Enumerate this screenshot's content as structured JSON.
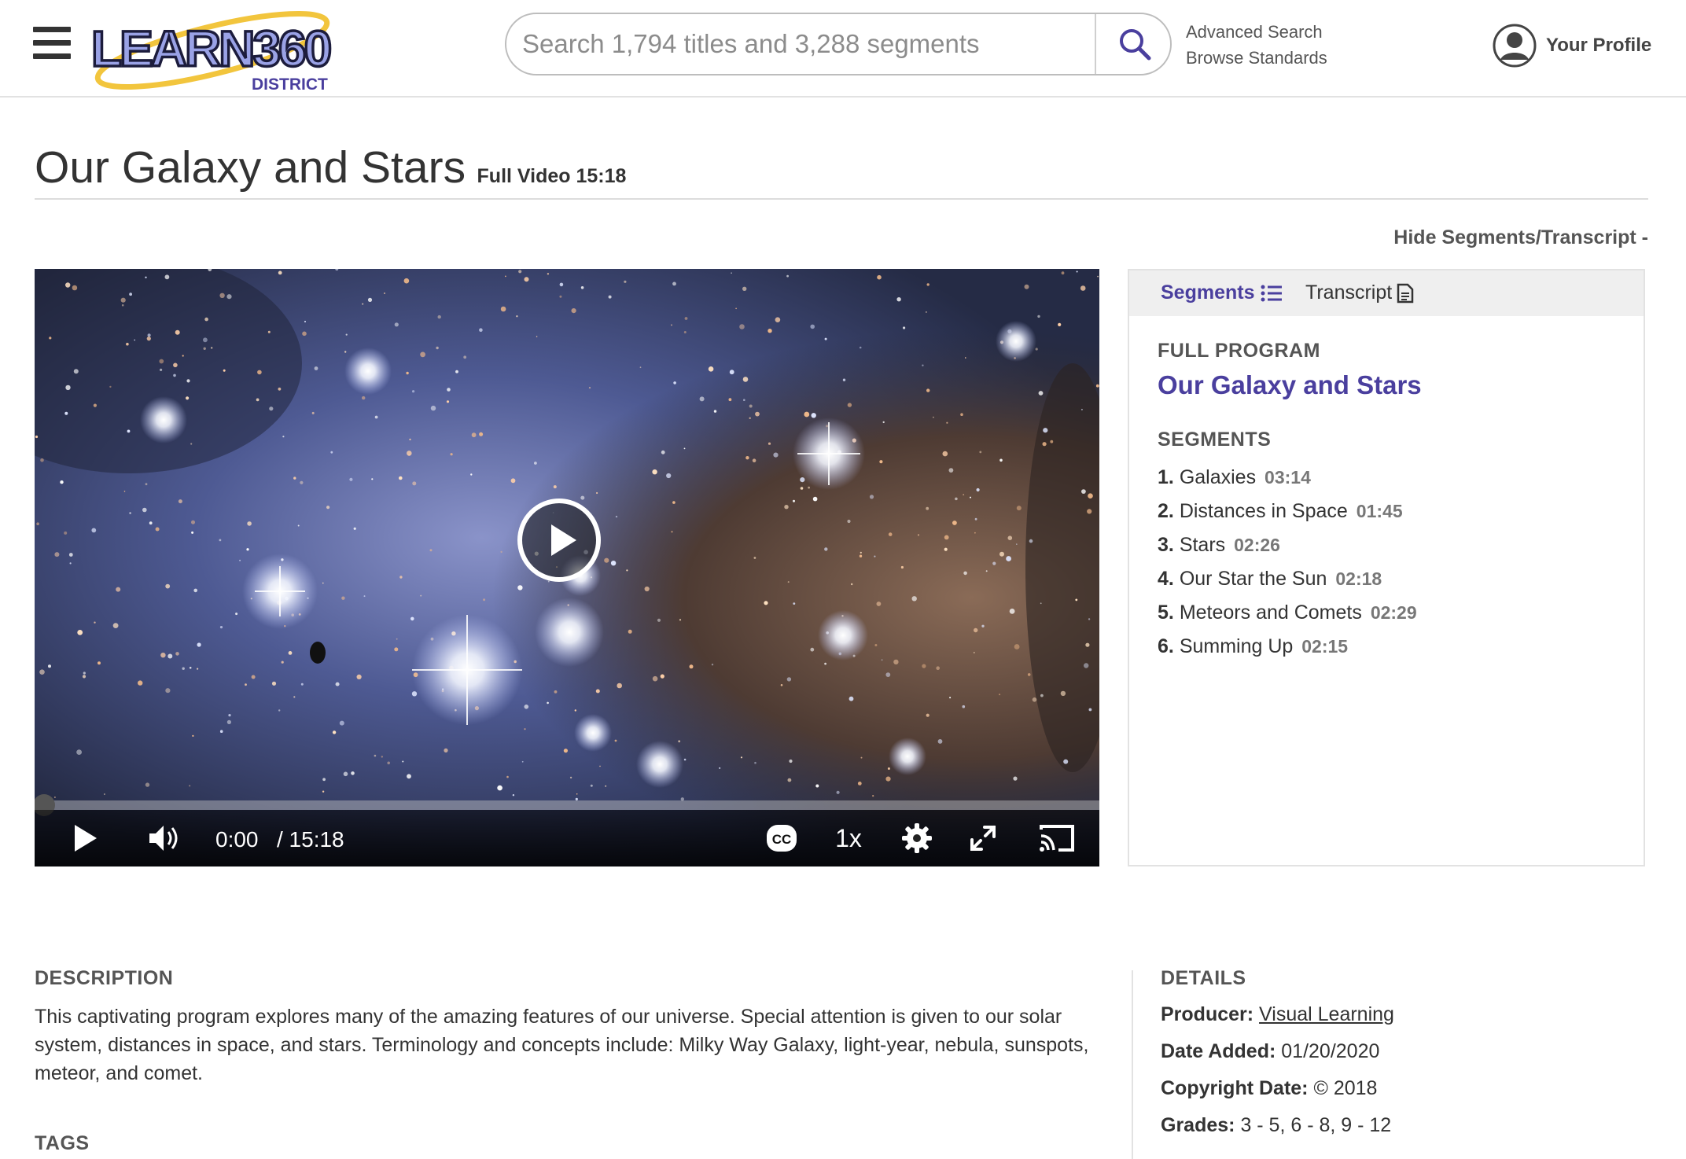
{
  "header": {
    "logo_text": "LEARN360",
    "logo_sub": "DISTRICT",
    "search_placeholder": "Search 1,794 titles and 3,288 segments",
    "links": [
      "Advanced Search",
      "Browse Standards"
    ],
    "profile_label": "Your Profile"
  },
  "page": {
    "title": "Our Galaxy and Stars",
    "subtitle": "Full Video 15:18",
    "hide_toggle": "Hide Segments/Transcript -"
  },
  "player": {
    "current_time": "0:00",
    "duration": "/ 15:18",
    "speed": "1x",
    "progress_fraction": 0
  },
  "panel": {
    "tabs": {
      "segments": "Segments",
      "transcript": "Transcript"
    },
    "full_program_label": "FULL PROGRAM",
    "program_title": "Our Galaxy and Stars",
    "segments_label": "SEGMENTS",
    "segments": [
      {
        "num": "1.",
        "title": "Galaxies",
        "duration": "03:14"
      },
      {
        "num": "2.",
        "title": "Distances in Space",
        "duration": "01:45"
      },
      {
        "num": "3.",
        "title": "Stars",
        "duration": "02:26"
      },
      {
        "num": "4.",
        "title": "Our Star the Sun",
        "duration": "02:18"
      },
      {
        "num": "5.",
        "title": "Meteors and Comets",
        "duration": "02:29"
      },
      {
        "num": "6.",
        "title": "Summing Up",
        "duration": "02:15"
      }
    ]
  },
  "description": {
    "label": "DESCRIPTION",
    "text": "This captivating program explores many of the amazing features of our universe. Special attention is given to our solar system, distances in space, and stars. Terminology and concepts include: Milky Way Galaxy, light-year, nebula, sunspots, meteor, and comet.",
    "tags_label": "TAGS"
  },
  "details": {
    "label": "DETAILS",
    "producer_key": "Producer:",
    "producer_value": "Visual Learning",
    "date_added_key": "Date Added:",
    "date_added_value": "01/20/2020",
    "copyright_key": "Copyright Date:",
    "copyright_symbol": "©",
    "copyright_value": "2018",
    "grades_key": "Grades:",
    "grades_value": "3 - 5, 6 - 8, 9 - 12"
  },
  "colors": {
    "brand_purple": "#4a3f9e",
    "text_dark": "#333333",
    "text_muted": "#555555",
    "panel_tab_bg": "#efefef"
  },
  "icons": {
    "menu": "hamburger-icon",
    "search": "search-icon",
    "profile": "user-avatar-icon",
    "segments_tab": "list-icon",
    "transcript_tab": "document-icon",
    "big_play": "play-circle-icon",
    "play": "play-icon",
    "volume": "volume-icon",
    "captions": "cc-icon",
    "settings": "gear-icon",
    "fullscreen": "fullscreen-icon",
    "cast": "cast-icon"
  }
}
